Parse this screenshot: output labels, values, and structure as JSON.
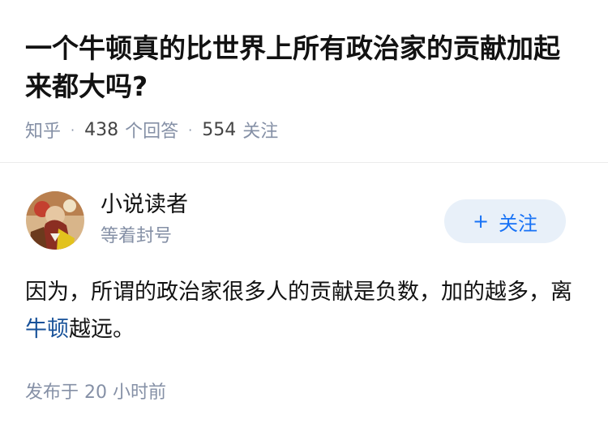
{
  "question": {
    "title": "一个牛顿真的比世界上所有政治家的贡献加起来都大吗?",
    "source": "知乎",
    "separator": "·",
    "answer_count": "438",
    "answer_label": "个回答",
    "follower_count": "554",
    "follower_label": "关注"
  },
  "author": {
    "name": "小说读者",
    "bio": "等着封号",
    "follow_icon": "plus-icon",
    "follow_symbol": "+",
    "follow_label": "关注",
    "accent_color": "#1772f6"
  },
  "answer": {
    "text_before": "因为，所谓的政治家很多人的贡献是负数，加的越多，离",
    "link_text": "牛顿",
    "text_after": "越远。",
    "link_color": "#175199"
  },
  "footer": {
    "published_label": "发布于",
    "published_time": "20 小时前"
  }
}
